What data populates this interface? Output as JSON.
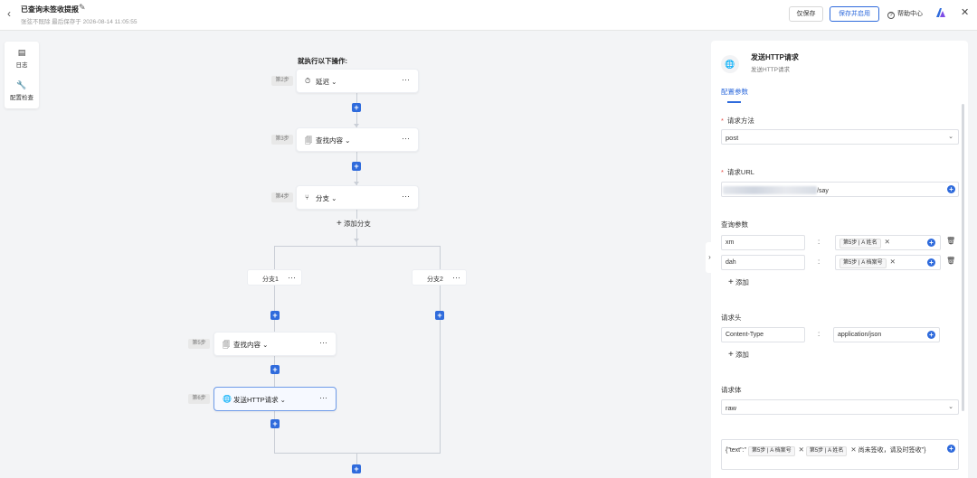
{
  "header": {
    "title": "已查询未签收提报",
    "subtitle": "张弦不既除 最后保存于 2026-08-14 11:05:55",
    "save_label": "仅保存",
    "save_enable_label": "保存并启用",
    "help_label": "帮助中心",
    "accent_color": "#2f6bdc"
  },
  "left_tools": [
    {
      "label": "日志",
      "icon": "log-icon"
    },
    {
      "label": "配置检查",
      "icon": "wrench-icon"
    }
  ],
  "canvas": {
    "title": "就执行以下操作:",
    "add_branch_label": "添加分支",
    "steps": [
      {
        "step": "第2步",
        "label": "延迟",
        "icon": "clock-icon"
      },
      {
        "step": "第3步",
        "label": "查找内容",
        "icon": "search-doc-icon"
      },
      {
        "step": "第4步",
        "label": "分支",
        "icon": "branch-icon"
      },
      {
        "step": "第5步",
        "label": "查找内容",
        "icon": "search-doc-icon"
      },
      {
        "step": "第6步",
        "label": "发送HTTP请求",
        "icon": "globe-icon"
      }
    ],
    "branches": [
      {
        "label": "分支1"
      },
      {
        "label": "分支2"
      }
    ]
  },
  "panel": {
    "title": "发送HTTP请求",
    "subtitle": "发送HTTP请求",
    "tab": "配置参数",
    "method_label": "请求方法",
    "method_value": "post",
    "url_label": "请求URL",
    "url_suffix": "/say",
    "query_label": "查询参数",
    "query_params": [
      {
        "key": "xm",
        "tag_step": "第5步",
        "tag_field": "姓名"
      },
      {
        "key": "dah",
        "tag_step": "第5步",
        "tag_field": "档案号"
      }
    ],
    "add_label": "添加",
    "headers_label": "请求头",
    "header_key": "Content-Type",
    "header_value": "application/json",
    "body_label": "请求体",
    "body_type": "raw",
    "body_prefix": "{\"text\":\"",
    "body_tag1_step": "第5步",
    "body_tag1_field": "档案号",
    "body_tag2_step": "第5步",
    "body_tag2_field": "姓名",
    "body_suffix": "尚未签收，请及时签收\"}"
  }
}
